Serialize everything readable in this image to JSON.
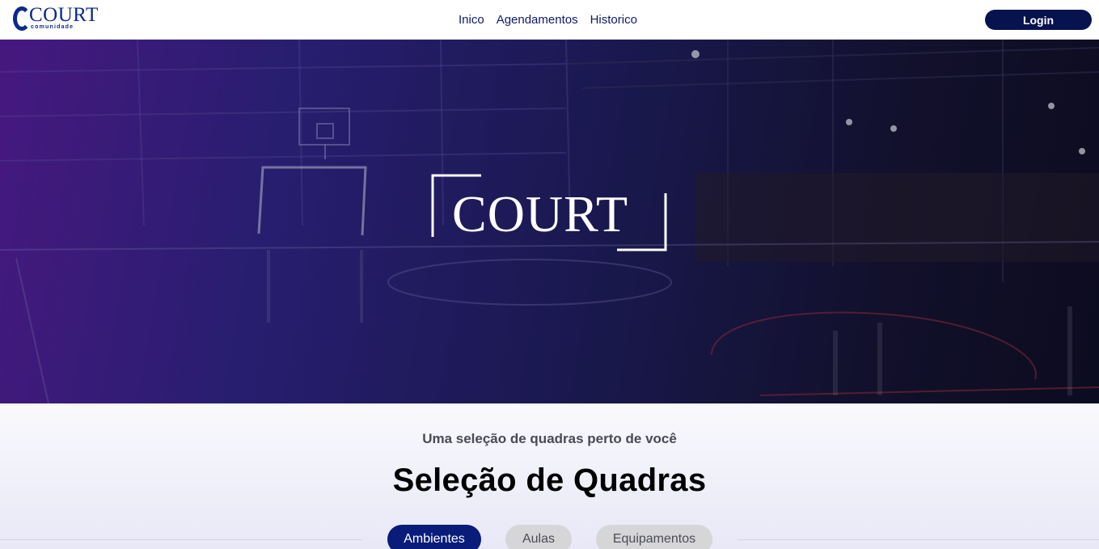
{
  "header": {
    "logo": {
      "word": "COURT",
      "tagline": "comunidade"
    },
    "nav": [
      {
        "label": "Inico"
      },
      {
        "label": "Agendamentos"
      },
      {
        "label": "Historico"
      }
    ],
    "login_label": "Login"
  },
  "hero": {
    "logo_word": "COURT"
  },
  "selection": {
    "subtitle": "Uma seleção de quadras perto de você",
    "title": "Seleção de Quadras",
    "tabs": [
      {
        "label": "Ambientes",
        "active": true
      },
      {
        "label": "Aulas",
        "active": false
      },
      {
        "label": "Equipamentos",
        "active": false
      }
    ]
  },
  "colors": {
    "brand_blue": "#0b2a8c",
    "login_bg": "#07134f",
    "active_tab": "#0a1c7a",
    "inactive_tab": "#d6d6d9"
  }
}
